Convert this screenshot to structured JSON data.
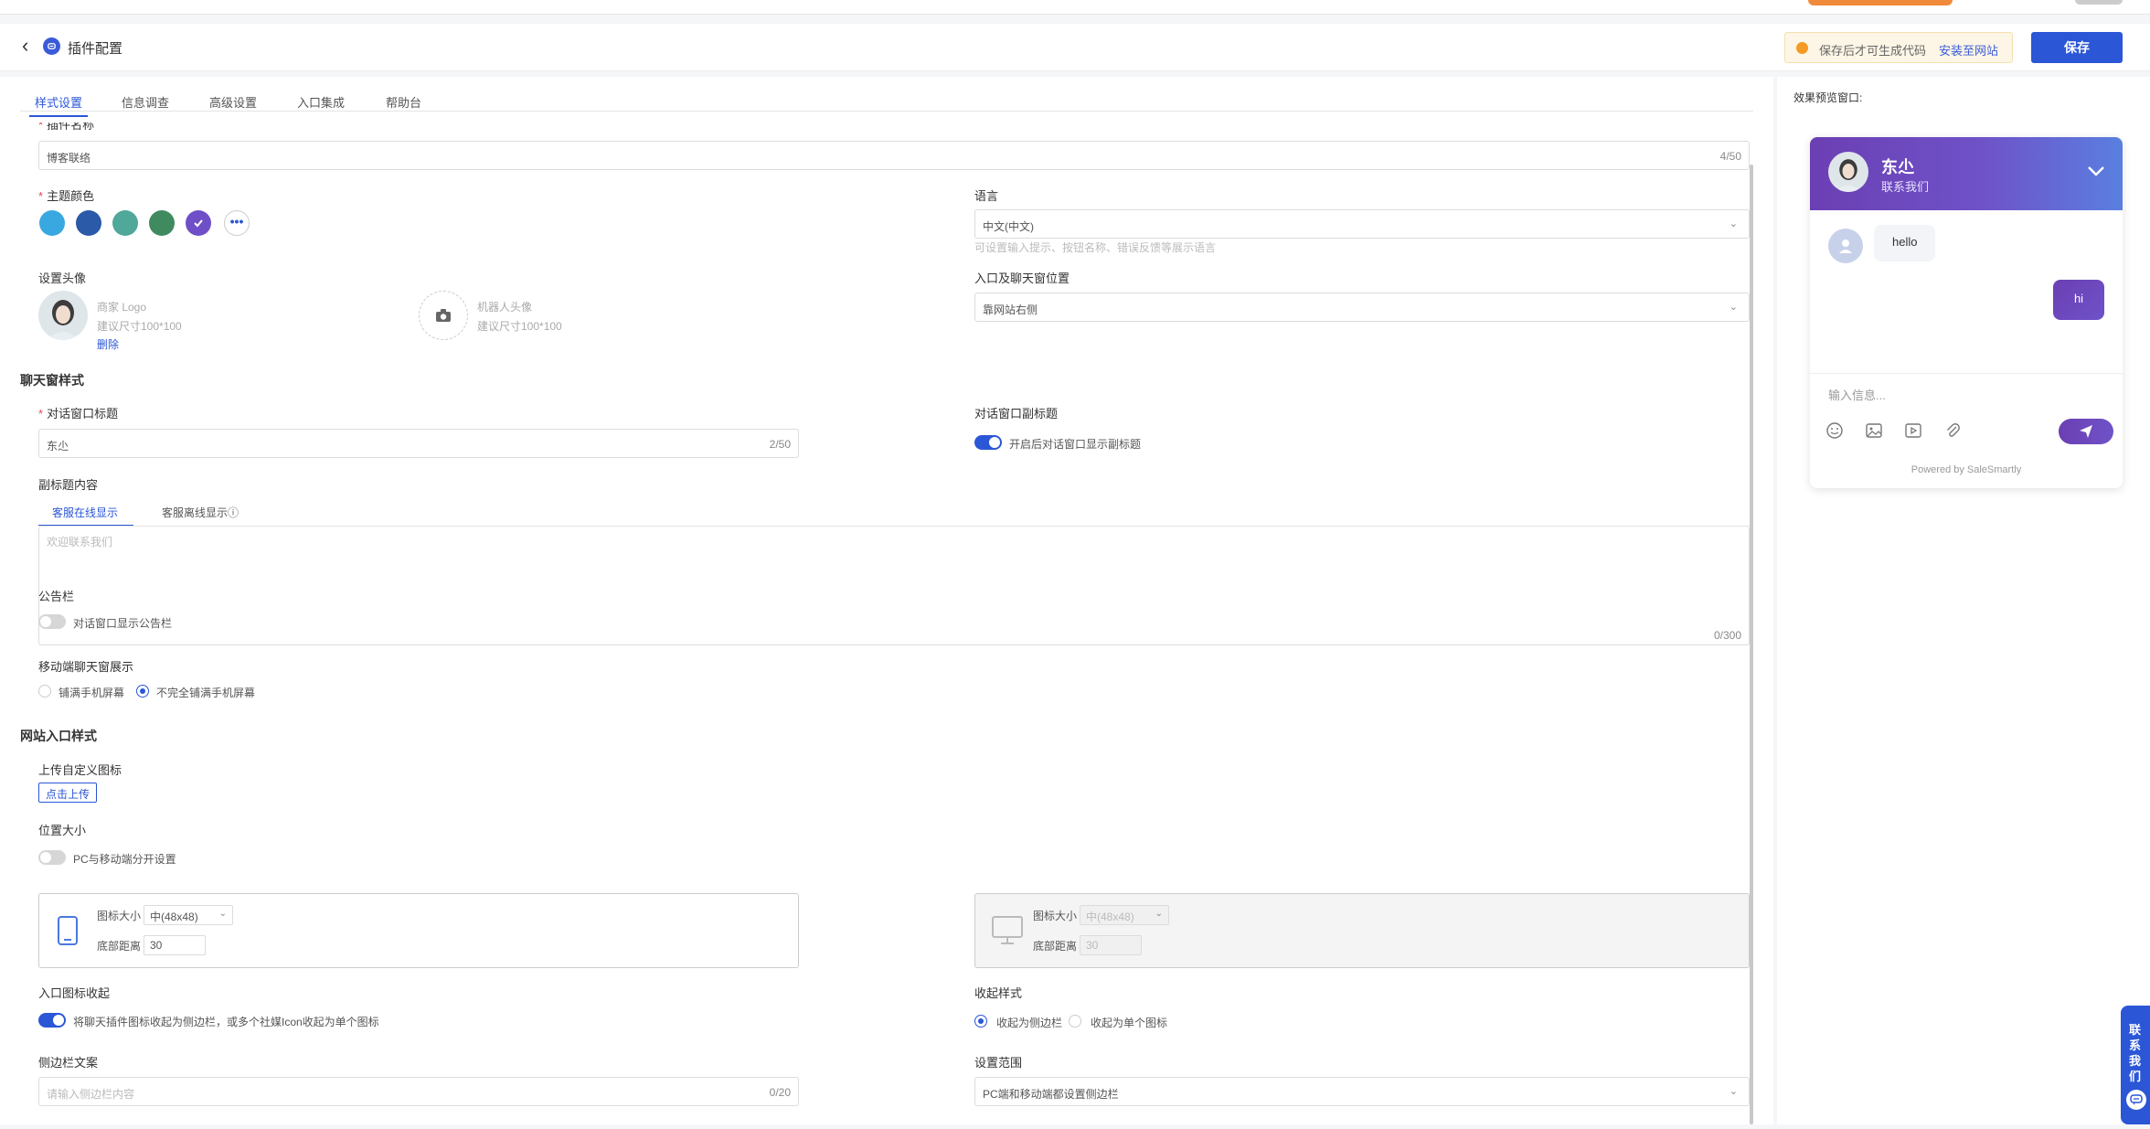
{
  "header": {
    "title": "插件配置",
    "notice_text": "保存后才可生成代码",
    "notice_link": "安装至网站",
    "save_label": "保存"
  },
  "tabs": [
    "样式设置",
    "信息调查",
    "高级设置",
    "入口集成",
    "帮助台"
  ],
  "active_tab": "样式设置",
  "form": {
    "plugin_name_label": "插件名称",
    "plugin_name_value": "博客联络",
    "plugin_name_count": "4/50",
    "theme_color_label": "主题颜色",
    "theme_colors": [
      "#3aa8e0",
      "#2a5aa8",
      "#4fa89a",
      "#3f8a5e",
      "#6f4fc8"
    ],
    "language_label": "语言",
    "language_value": "中文(中文)",
    "language_hint": "可设置输入提示、按钮名称、错误反馈等展示语言",
    "avatar_label": "设置头像",
    "merchant_logo": "商家 Logo",
    "avatar_size_hint": "建议尺寸100*100",
    "delete_label": "删除",
    "robot_avatar": "机器人头像",
    "robot_size_hint": "建议尺寸100*100",
    "entry_pos_label": "入口及聊天窗位置",
    "entry_pos_value": "靠网站右侧",
    "chat_style_title": "聊天窗样式",
    "dialog_title_label": "对话窗口标题",
    "dialog_title_value": "东尐",
    "dialog_title_count": "2/50",
    "dialog_subtitle_label": "对话窗口副标题",
    "dialog_subtitle_toggle": "开启后对话窗口显示副标题",
    "subtitle_content_label": "副标题内容",
    "subtab_online": "客服在线显示",
    "subtab_offline": "客服离线显示ⓘ",
    "subtitle_placeholder": "欢迎联系我们",
    "subtitle_count": "0/300",
    "bulletin_label": "公告栏",
    "bulletin_toggle": "对话窗口显示公告栏",
    "mobile_label": "移动端聊天窗展示",
    "mobile_opt1": "铺满手机屏幕",
    "mobile_opt2": "不完全铺满手机屏幕",
    "entry_style_title": "网站入口样式",
    "upload_icon_label": "上传自定义图标",
    "upload_btn": "点击上传",
    "pos_size_label": "位置大小",
    "pos_size_toggle": "PC与移动端分开设置",
    "icon_size_label": "图标大小",
    "icon_size_value": "中(48x48)",
    "bottom_dist_label": "底部距离",
    "bottom_dist_value": "30",
    "icon_size_label_pc": "图标大小",
    "icon_size_value_pc": "中(48x48)",
    "bottom_dist_label_pc": "底部距离",
    "bottom_dist_value_pc": "30",
    "collapse_label": "入口图标收起",
    "collapse_toggle": "将聊天插件图标收起为侧边栏，或多个社媒Icon收起为单个图标",
    "collapse_style_label": "收起样式",
    "collapse_opt1": "收起为侧边栏",
    "collapse_opt2": "收起为单个图标",
    "sidebar_text_label": "侧边栏文案",
    "sidebar_text_placeholder": "请输入侧边栏内容",
    "sidebar_text_count": "0/20",
    "scope_label": "设置范围",
    "scope_value": "PC端和移动端都设置侧边栏"
  },
  "preview": {
    "label": "效果预览窗口:",
    "name": "东尐",
    "subtitle": "联系我们",
    "msg_in": "hello",
    "msg_out": "hi",
    "input_placeholder": "输入信息...",
    "powered": "Powered by SaleSmartly"
  },
  "float_button": "联系我们",
  "colors": {
    "primary": "#2b56d6",
    "chat_gradient_start": "#6b3fb3",
    "chat_gradient_end": "#5a7fe0"
  }
}
